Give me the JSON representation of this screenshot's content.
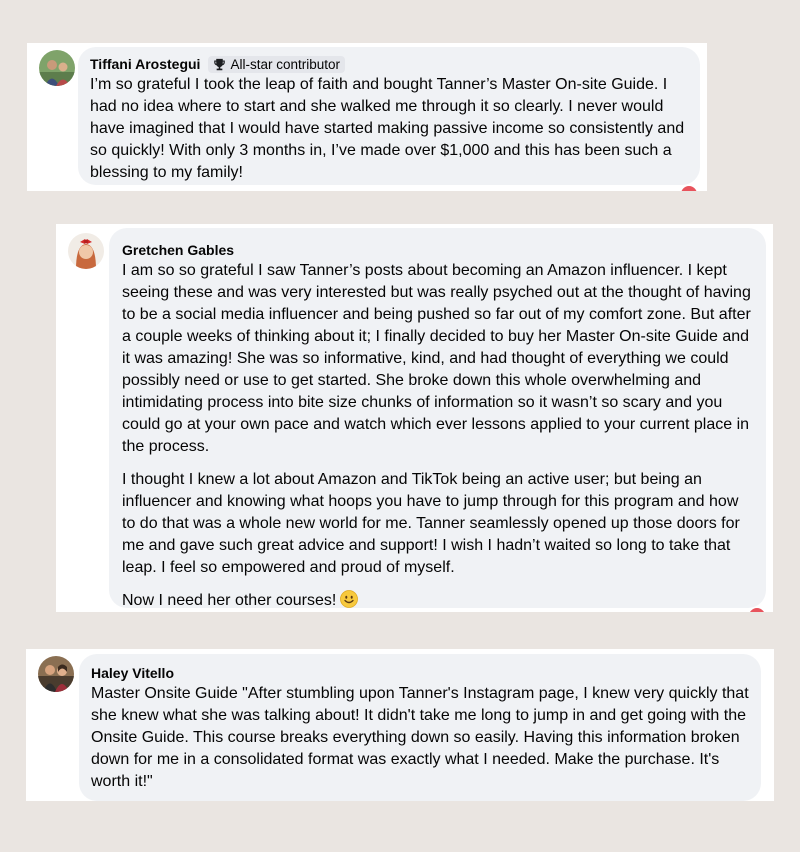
{
  "comments": [
    {
      "author": "Tiffani Arostegui",
      "badge": "All-star contributor",
      "badge_icon": "trophy-icon",
      "paragraphs": [
        "I’m so grateful I took the leap of faith and bought Tanner’s Master On-site Guide. I had no idea where to start and she walked me through it so clearly. I never would have imagined that I would have started making passive income so consistently and so quickly! With only 3 months in, I’ve made over $1,000 and this has been such a blessing to my family!"
      ]
    },
    {
      "author": "Gretchen Gables",
      "paragraphs": [
        "I am so so grateful I saw Tanner’s posts about becoming an Amazon influencer. I kept seeing these and was very interested but was really psyched out at the thought of having to be a social media influencer and being pushed so far out of my comfort zone. But after a couple weeks of thinking about it; I finally decided to buy her Master On-site Guide and it was amazing! She was so informative, kind, and had thought of everything we could possibly need or use to get started. She broke down this whole overwhelming and intimidating process into bite size chunks of information so it wasn’t so scary and you could go at your own pace and watch which ever lessons applied to your current place in the process.",
        "I thought I knew a lot about Amazon and TikTok being an active user; but being an influencer and knowing what hoops you have to jump through for this program and how to do that was a whole new world for me. Tanner seamlessly opened up those doors for me and gave such great advice and support! I wish I hadn’t waited so long to take that leap. I feel so empowered and proud of myself.",
        "Now I need her other courses!"
      ],
      "trailing_emoji": "smiley-emoji"
    },
    {
      "author": "Haley Vitello",
      "paragraphs": [
        "Master Onsite Guide \"After stumbling upon Tanner's Instagram page, I knew very quickly that she knew what she was talking about! It didn't take me long to jump in and get going with the Onsite Guide. This course breaks everything down so easily. Having this information broken down for me in a consolidated format was exactly what I needed. Make the purchase. It's worth it!\""
      ]
    }
  ],
  "colors": {
    "page_background": "#eae5e1",
    "card_background": "#ffffff",
    "bubble_background": "#f0f2f5",
    "text": "#050505",
    "badge_background": "#e4e6eb",
    "reaction": "#e8535c"
  }
}
